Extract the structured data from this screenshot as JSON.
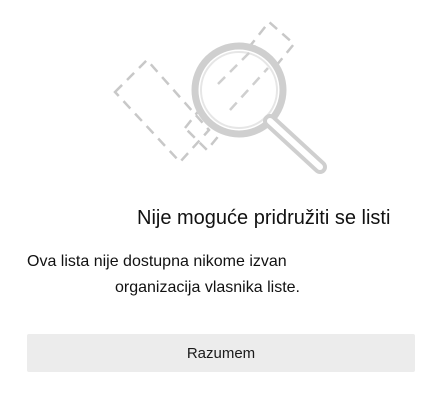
{
  "illustration": {
    "icon": "broken-list-magnifier-icon",
    "stroke_color": "#c8c8c8",
    "lens_color": "#cfcfcf"
  },
  "dialog": {
    "title": "Nije moguće pridružiti se listi",
    "message_line_1": "Ova lista nije dostupna nikome izvan",
    "message_line_2": "organizacija vlasnika liste.",
    "button_label": "Razumem"
  }
}
